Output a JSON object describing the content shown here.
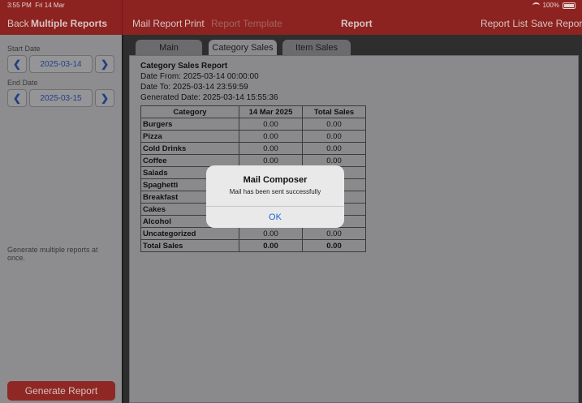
{
  "status_bar": {
    "time": "3:55 PM",
    "date": "Fri 14 Mar",
    "battery": "100%"
  },
  "header": {
    "back_label": "Back",
    "section_title": "Multiple Reports",
    "mail_report": "Mail Report",
    "print": "Print",
    "report_template": "Report Template",
    "title": "Report",
    "report_list": "Report List",
    "save_report": "Save Report"
  },
  "sidebar": {
    "start_date_label": "Start Date",
    "start_date": "2025-03-14",
    "end_date_label": "End Date",
    "end_date": "2025-03-15",
    "note": "Generate multiple reports at once.",
    "generate_button": "Generate Report"
  },
  "tabs": [
    {
      "label": "Main"
    },
    {
      "label": "Category Sales"
    },
    {
      "label": "Item Sales"
    }
  ],
  "report": {
    "title": "Category Sales Report",
    "date_from": "Date From: 2025-03-14 00:00:00",
    "date_to": "Date To: 2025-03-14 23:59:59",
    "generated": "Generated Date: 2025-03-14 15:55:36",
    "columns": [
      "Category",
      "14 Mar 2025",
      "Total Sales"
    ],
    "rows": [
      {
        "name": "Burgers",
        "v1": "0.00",
        "v2": "0.00"
      },
      {
        "name": "Pizza",
        "v1": "0.00",
        "v2": "0.00"
      },
      {
        "name": "Cold Drinks",
        "v1": "0.00",
        "v2": "0.00"
      },
      {
        "name": "Coffee",
        "v1": "0.00",
        "v2": "0.00"
      },
      {
        "name": "Salads",
        "v1": "",
        "v2": ""
      },
      {
        "name": "Spaghetti",
        "v1": "",
        "v2": ""
      },
      {
        "name": "Breakfast",
        "v1": "",
        "v2": ""
      },
      {
        "name": "Cakes",
        "v1": "",
        "v2": ""
      },
      {
        "name": "Alcohol",
        "v1": "",
        "v2": ""
      },
      {
        "name": "Uncategorized",
        "v1": "0.00",
        "v2": "0.00"
      }
    ],
    "total": {
      "name": "Total Sales",
      "v1": "0.00",
      "v2": "0.00"
    }
  },
  "alert": {
    "title": "Mail Composer",
    "message": "Mail has been sent successfully",
    "ok": "OK"
  },
  "icons": {
    "prev": "chevron-left-icon",
    "next": "chevron-right-icon",
    "wifi": "wifi-icon",
    "battery": "battery-icon"
  }
}
